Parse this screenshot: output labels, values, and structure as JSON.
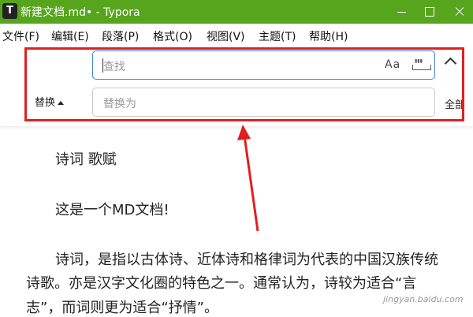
{
  "window": {
    "app_icon": "T",
    "title": "新建文档.md• - Typora"
  },
  "menu": [
    "文件(F)",
    "编辑(E)",
    "段落(P)",
    "格式(O)",
    "视图(V)",
    "主题(T)",
    "帮助(H)"
  ],
  "find": {
    "placeholder": "查找",
    "case_label": "Aa",
    "whole_word_icon": "whole-word-icon"
  },
  "replace": {
    "toggle_label": "替换",
    "placeholder": "替换为",
    "all_label": "全部"
  },
  "document": {
    "heading": "诗词 歌赋",
    "line1": "这是一个MD文档!",
    "para_line1": "诗词，是指以古体诗、近体诗和格律词为代表的中国汉族传统",
    "para_line2": "诗歌。亦是汉字文化圈的特色之一。通常认为，诗较为适合“言",
    "para_line3": "志”，而词则更为适合“抒情”。"
  },
  "annotation": {
    "box_color": "#e02020",
    "arrow_color": "#e02020"
  },
  "watermark": "jingyan.baidu.com",
  "colors": {
    "titlebar": "#56a51d",
    "focus_border": "#3d83d9"
  }
}
